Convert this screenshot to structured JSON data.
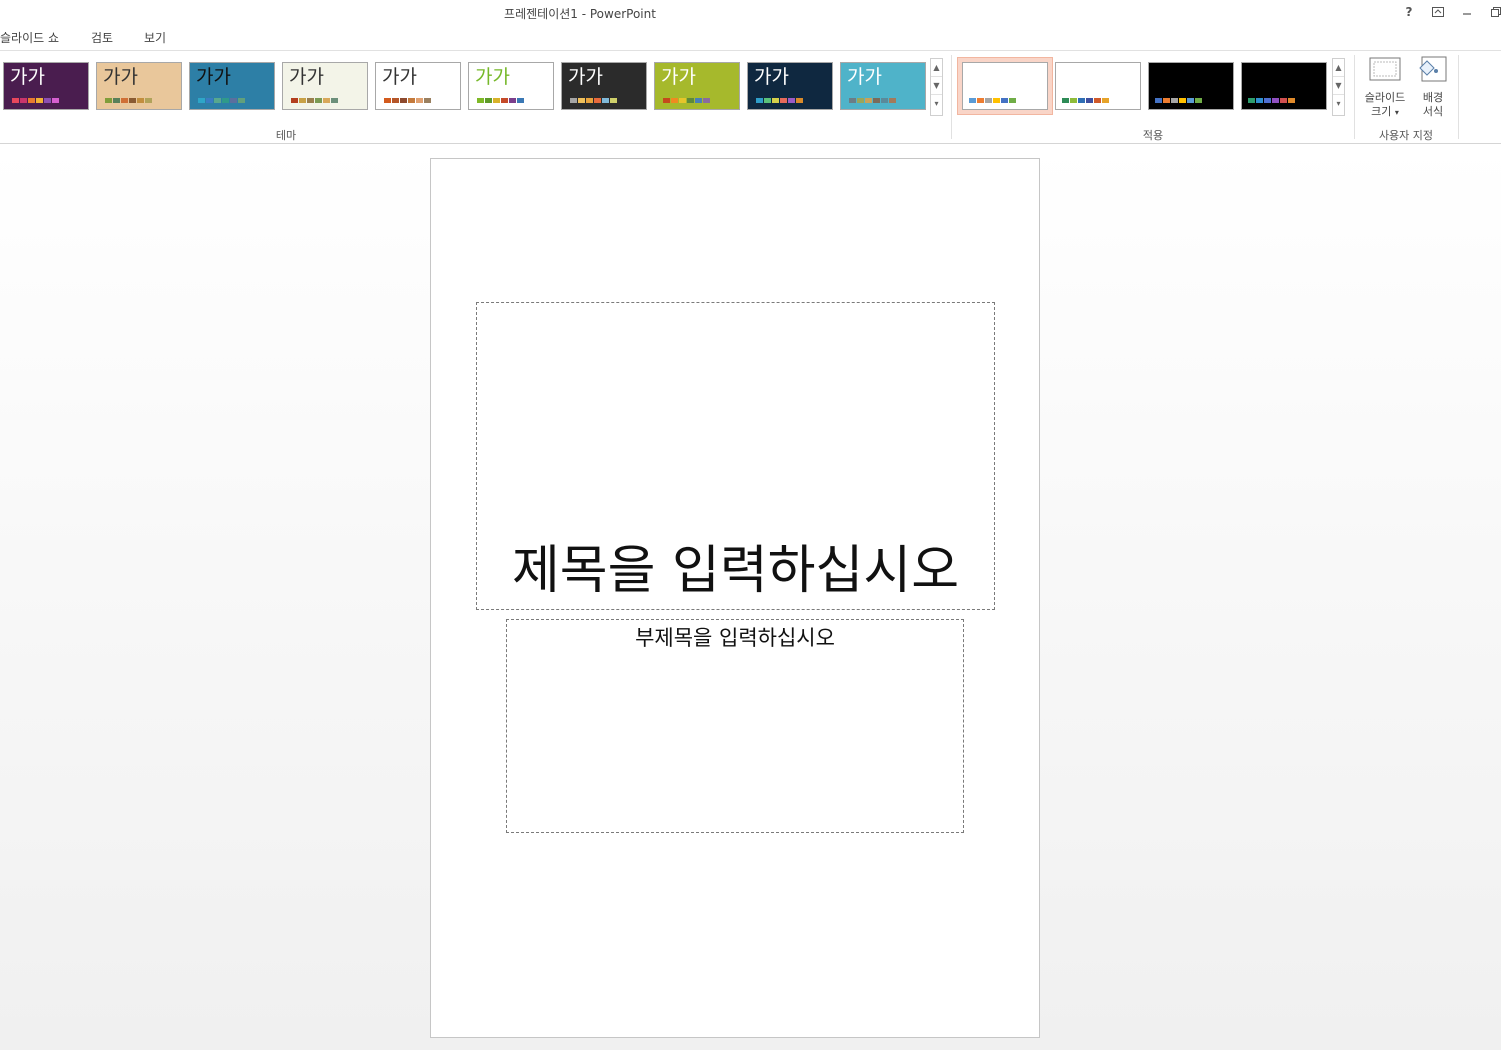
{
  "window": {
    "title": "프레젠테이션1 - PowerPoint",
    "help_label": "?"
  },
  "tabs": [
    {
      "label": "슬라이드 쇼"
    },
    {
      "label": "검토"
    },
    {
      "label": "보기"
    }
  ],
  "ribbon": {
    "theme_group_label": "테마",
    "variants_group_label": "적용",
    "customize_group_label": "사용자 지정",
    "theme_sample_text": "가가",
    "slide_size": {
      "line1": "슬라이드",
      "line2": "크기"
    },
    "format_background": {
      "line1": "배경",
      "line2": "서식"
    },
    "themes": [
      {
        "bg": "#4a1d4f",
        "text": "#ffffff",
        "swatches": [
          "#e8475c",
          "#c9356b",
          "#e97b2f",
          "#f2b134",
          "#8c4fb3",
          "#d65fcf"
        ]
      },
      {
        "bg": "#e9c79b",
        "text": "#333333",
        "swatches": [
          "#7f9d3a",
          "#59805a",
          "#cf6f36",
          "#8a5b32",
          "#c28e3e",
          "#b0a35a"
        ]
      },
      {
        "bg": "#2d7fa6",
        "text": "#111111",
        "swatches": [
          "#2ea6c8",
          "#3a7cc2",
          "#58a88e",
          "#2f9a8a",
          "#5b6f9e",
          "#61a07b"
        ]
      },
      {
        "bg": "#f3f4e8",
        "text": "#333333",
        "swatches": [
          "#b33e1e",
          "#c8a145",
          "#9a7f4c",
          "#7a9b54",
          "#d8a85a",
          "#6b8f7a"
        ]
      },
      {
        "bg": "#ffffff",
        "text": "#333333",
        "swatches": [
          "#d35b1e",
          "#b5562a",
          "#8e4a2e",
          "#c47a3c",
          "#e0a070",
          "#9a8060"
        ]
      },
      {
        "bg": "#ffffff",
        "text": "#76b82a",
        "swatches": [
          "#7fb927",
          "#5e9b2a",
          "#d8b22a",
          "#c54a2a",
          "#7b3f8c",
          "#3a78b5"
        ]
      },
      {
        "bg": "#2b2b2b",
        "text": "#ffffff",
        "swatches": [
          "#a5a5a5",
          "#f0c05a",
          "#e8a33c",
          "#e86a3c",
          "#7fb8d8",
          "#cfd06a"
        ]
      },
      {
        "bg": "#a6b92c",
        "text": "#ffffff",
        "swatches": [
          "#c44a1c",
          "#ef8a20",
          "#e6c52a",
          "#5c8a3a",
          "#4a7fb5",
          "#8a6b9e"
        ]
      },
      {
        "bg": "#0f2840",
        "text": "#ffffff",
        "swatches": [
          "#2f9ec9",
          "#5bc27a",
          "#d6d04a",
          "#e66a5a",
          "#9b5bc5",
          "#d98a2a"
        ]
      },
      {
        "bg": "#4fb3c9",
        "text": "#ffffff",
        "swatches": [
          "#6b7d86",
          "#9aa65a",
          "#c8a25a",
          "#7a6b5a",
          "#5a8a9a",
          "#a37a5a"
        ]
      }
    ],
    "variants": [
      {
        "bg": "#ffffff",
        "swatches": [
          "#5b9bd5",
          "#ed7d31",
          "#a5a5a5",
          "#ffc000",
          "#4472c4",
          "#70ad47"
        ]
      },
      {
        "bg": "#ffffff",
        "swatches": [
          "#2e8b57",
          "#8fbc3a",
          "#2f6eb5",
          "#3f4f9f",
          "#d05a2a",
          "#e6a32a"
        ]
      },
      {
        "bg": "#000000",
        "swatches": [
          "#4472c4",
          "#ed7d31",
          "#a5a5a5",
          "#ffc000",
          "#5b9bd5",
          "#70ad47"
        ]
      },
      {
        "bg": "#000000",
        "swatches": [
          "#2e9e6e",
          "#2f8fd0",
          "#4f6fd0",
          "#8f4fc0",
          "#d04f4f",
          "#e08a2a"
        ]
      }
    ]
  },
  "slide": {
    "title_placeholder": "제목을 입력하십시오",
    "subtitle_placeholder": "부제목을 입력하십시오"
  }
}
